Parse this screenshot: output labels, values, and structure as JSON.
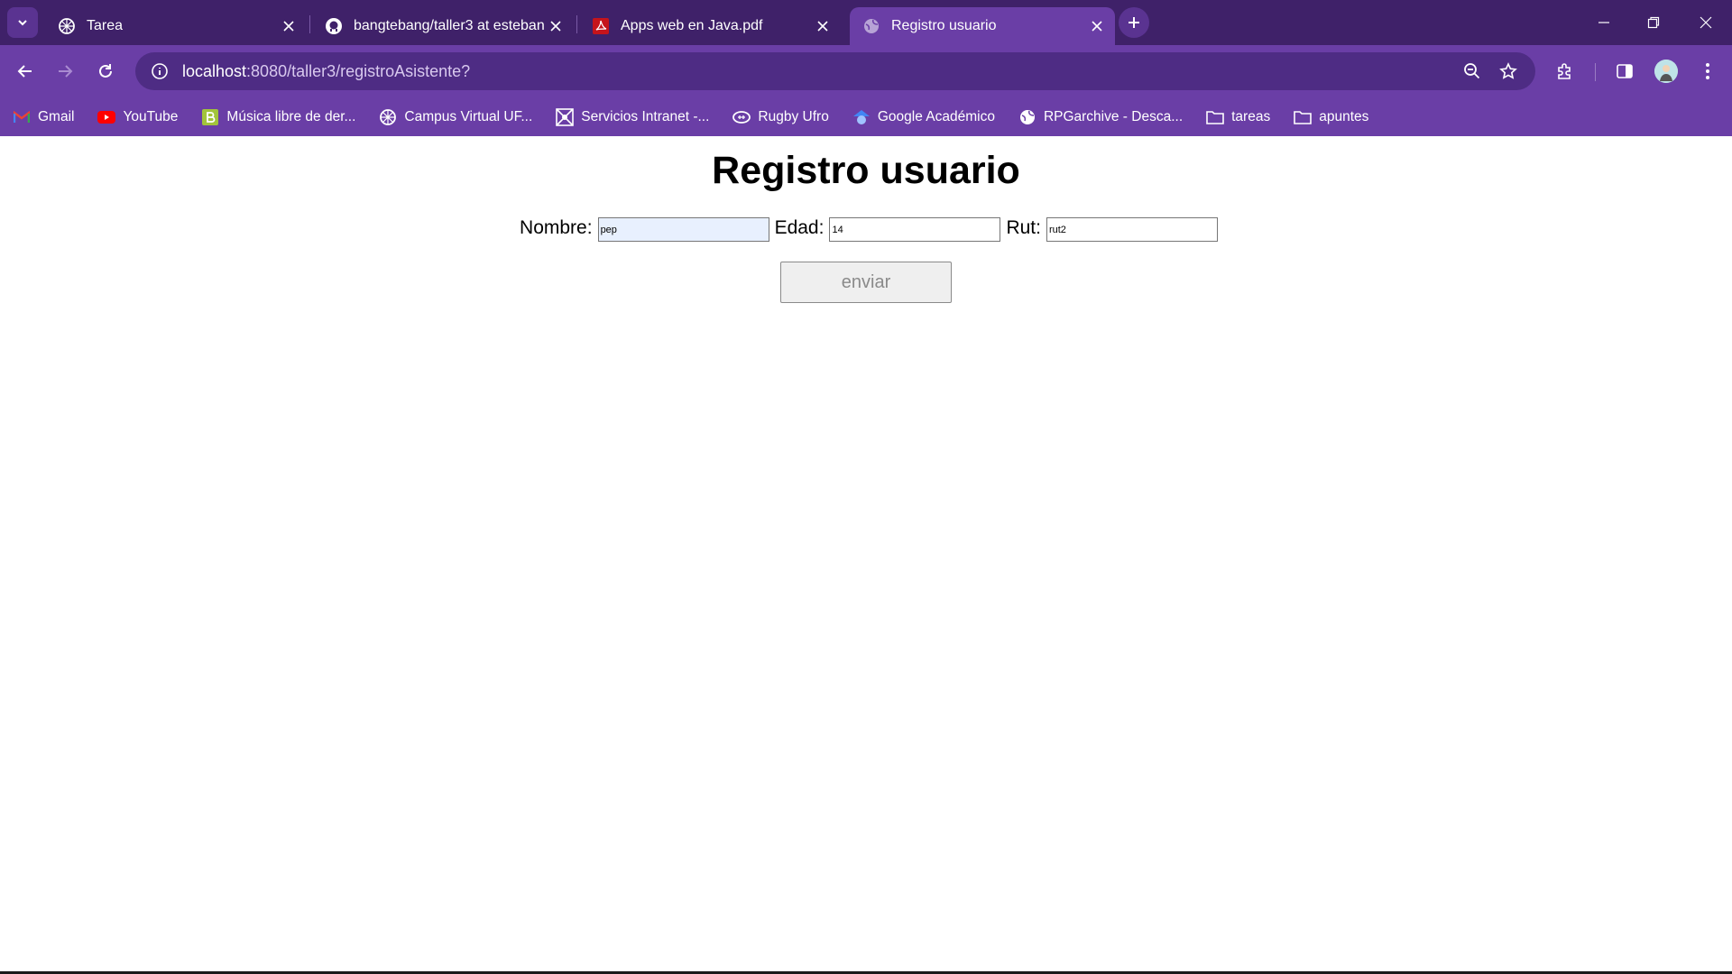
{
  "browser": {
    "tabs": [
      {
        "title": "Tarea",
        "icon": "moodle-icon",
        "active": false
      },
      {
        "title": "bangtebang/taller3 at esteban",
        "icon": "github-icon",
        "active": false
      },
      {
        "title": "Apps web en Java.pdf",
        "icon": "pdf-icon",
        "active": false
      },
      {
        "title": "Registro usuario",
        "icon": "globe-icon",
        "active": true
      }
    ],
    "url_host": "localhost",
    "url_rest": ":8080/taller3/registroAsistente?",
    "bookmarks": [
      {
        "label": "Gmail",
        "icon": "gmail-icon"
      },
      {
        "label": "YouTube",
        "icon": "youtube-icon"
      },
      {
        "label": "Música libre de der...",
        "icon": "bandcamp-icon"
      },
      {
        "label": "Campus Virtual UF...",
        "icon": "moodle-icon"
      },
      {
        "label": "Servicios Intranet -...",
        "icon": "intranet-icon"
      },
      {
        "label": "Rugby Ufro",
        "icon": "rugby-icon"
      },
      {
        "label": "Google Académico",
        "icon": "scholar-icon"
      },
      {
        "label": "RPGarchive - Desca...",
        "icon": "globe-icon"
      },
      {
        "label": "tareas",
        "icon": "folder-icon"
      },
      {
        "label": "apuntes",
        "icon": "folder-icon"
      }
    ],
    "colors": {
      "tabbar": "#3f2169",
      "toolbar": "#6a3ea6",
      "omnibox": "#4e2c84"
    }
  },
  "page": {
    "heading": "Registro usuario",
    "form": {
      "nombre_label": "Nombre:",
      "nombre_value": "pep",
      "edad_label": "Edad:",
      "edad_value": "14",
      "rut_label": "Rut:",
      "rut_value": "rut2",
      "submit_label": "enviar"
    }
  }
}
